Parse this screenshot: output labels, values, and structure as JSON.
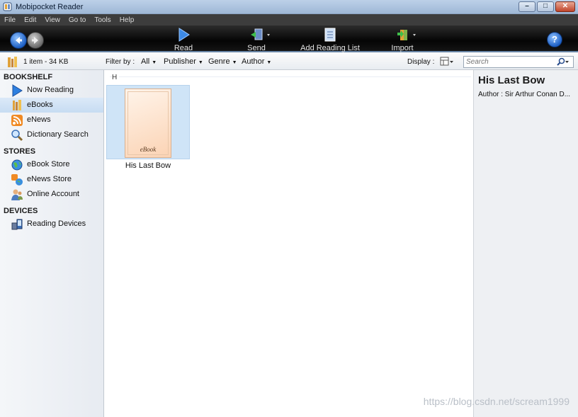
{
  "window": {
    "title": "Mobipocket Reader"
  },
  "menu": [
    "File",
    "Edit",
    "View",
    "Go to",
    "Tools",
    "Help"
  ],
  "toolbar": {
    "read_label": "Read",
    "send_label": "Send",
    "add_reading_list_label": "Add Reading List",
    "import_label": "Import",
    "help_label": "?"
  },
  "filterbar": {
    "item_count": "1 item - 34 KB",
    "filter_by_label": "Filter by :",
    "filters": [
      "All",
      "Publisher",
      "Genre",
      "Author"
    ],
    "display_label": "Display :",
    "search_placeholder": "Search"
  },
  "sidebar": {
    "sections": [
      {
        "title": "BOOKSHELF",
        "items": [
          {
            "label": "Now Reading",
            "icon": "play-icon"
          },
          {
            "label": "eBooks",
            "icon": "books-icon",
            "selected": true
          },
          {
            "label": "eNews",
            "icon": "rss-icon"
          },
          {
            "label": "Dictionary Search",
            "icon": "magnifier-icon"
          }
        ]
      },
      {
        "title": "STORES",
        "items": [
          {
            "label": "eBook Store",
            "icon": "globe-icon"
          },
          {
            "label": "eNews Store",
            "icon": "news-store-icon"
          },
          {
            "label": "Online Account",
            "icon": "account-icon"
          }
        ]
      },
      {
        "title": "DEVICES",
        "items": [
          {
            "label": "Reading Devices",
            "icon": "device-icon"
          }
        ]
      }
    ]
  },
  "library": {
    "group_letter": "H",
    "books": [
      {
        "title": "His Last Bow",
        "cover_text": "eBook"
      }
    ]
  },
  "detail": {
    "title": "His Last Bow",
    "author": "Author : Sir Arthur Conan D..."
  },
  "watermark": "https://blog.csdn.net/scream1999",
  "colors": {
    "toolbar_bg": "#0a0a0a",
    "selection": "#cfe4f7",
    "accent": "#1d5fc4"
  }
}
